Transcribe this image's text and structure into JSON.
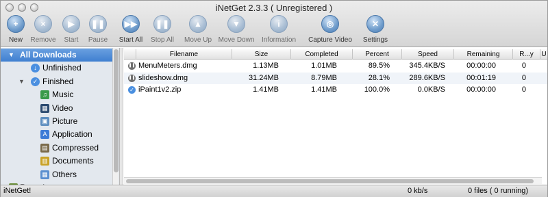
{
  "window": {
    "title": "iNetGet 2.3.3 ( Unregistered )"
  },
  "toolbar": {
    "buttons": [
      {
        "label": "New",
        "glyph": "+",
        "enabled": true
      },
      {
        "label": "Remove",
        "glyph": "×",
        "enabled": false
      },
      {
        "label": "Start",
        "glyph": "▶",
        "enabled": false
      },
      {
        "label": "Pause",
        "glyph": "❚❚",
        "enabled": false
      },
      {
        "label": "Start All",
        "glyph": "▶▶",
        "enabled": true
      },
      {
        "label": "Stop All",
        "glyph": "❚❚",
        "enabled": false
      },
      {
        "label": "Move Up",
        "glyph": "▲",
        "enabled": false
      },
      {
        "label": "Move Down",
        "glyph": "▼",
        "enabled": false
      },
      {
        "label": "Information",
        "glyph": "i",
        "enabled": false
      },
      {
        "label": "Capture Video",
        "glyph": "◎",
        "enabled": true
      },
      {
        "label": "Settings",
        "glyph": "✕",
        "enabled": true
      }
    ]
  },
  "sidebar": {
    "items": [
      {
        "label": "All Downloads",
        "level": 0,
        "expanded": true,
        "selected": true,
        "icon": "downloads-icon",
        "glyph": ""
      },
      {
        "label": "Unfinished",
        "level": 1,
        "icon": "unfinished-icon",
        "glyph": "↓",
        "color": "#4a8fe0"
      },
      {
        "label": "Finished",
        "level": 1,
        "expanded": true,
        "icon": "finished-icon",
        "glyph": "✓",
        "color": "#4a8fe0"
      },
      {
        "label": "Music",
        "level": 2,
        "icon": "music-icon",
        "glyph": "♫",
        "color": "#3a9a4a"
      },
      {
        "label": "Video",
        "level": 2,
        "icon": "video-icon",
        "glyph": "▦",
        "color": "#2b4a6f"
      },
      {
        "label": "Picture",
        "level": 2,
        "icon": "picture-icon",
        "glyph": "▣",
        "color": "#5f8fc0"
      },
      {
        "label": "Application",
        "level": 2,
        "icon": "application-icon",
        "glyph": "A",
        "color": "#3c7bd6"
      },
      {
        "label": "Compressed",
        "level": 2,
        "icon": "compressed-icon",
        "glyph": "▤",
        "color": "#7a6a4a"
      },
      {
        "label": "Documents",
        "level": 2,
        "icon": "documents-icon",
        "glyph": "▥",
        "color": "#c9a227"
      },
      {
        "label": "Others",
        "level": 2,
        "icon": "others-icon",
        "glyph": "▦",
        "color": "#5a8fd0"
      },
      {
        "label": "Recycle",
        "level": 0,
        "icon": "recycle-icon",
        "glyph": "♻",
        "color": "#6b8f3a"
      }
    ]
  },
  "table": {
    "columns": [
      "Filename",
      "Size",
      "Completed",
      "Percent",
      "Speed",
      "Remaining",
      "R...y",
      "U"
    ],
    "rows": [
      {
        "status": "paused",
        "filename": "MenuMeters.dmg",
        "size": "1.13MB",
        "completed": "1.01MB",
        "percent": "89.5%",
        "speed": "345.4KB/S",
        "remaining": "00:00:00",
        "retry": "0"
      },
      {
        "status": "paused",
        "filename": "slideshow.dmg",
        "size": "31.24MB",
        "completed": "8.79MB",
        "percent": "28.1%",
        "speed": "289.6KB/S",
        "remaining": "00:01:19",
        "retry": "0"
      },
      {
        "status": "finished",
        "filename": "iPaint1v2.zip",
        "size": "1.41MB",
        "completed": "1.41MB",
        "percent": "100.0%",
        "speed": "0.0KB/S",
        "remaining": "00:00:00",
        "retry": "0"
      }
    ]
  },
  "statusbar": {
    "app": "iNetGet!",
    "speed": "0 kb/s",
    "files": "0 files ( 0 running)"
  },
  "colors": {
    "selection": "#3f7fd0",
    "toolbar_icon": "#6f9ccb"
  }
}
